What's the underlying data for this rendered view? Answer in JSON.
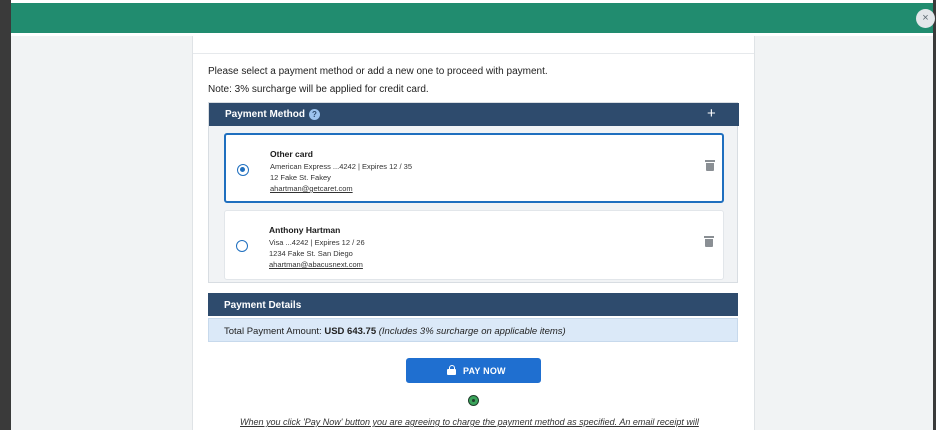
{
  "window": {
    "close_symbol": "×",
    "accent_color": "#218c6f"
  },
  "intro": {
    "line1": "Please select a payment method or add a new one to proceed with payment.",
    "line2": "Note: 3% surcharge will be applied for credit card."
  },
  "payment_method": {
    "title": "Payment Method",
    "help_symbol": "?",
    "add_symbol": "+",
    "cards": [
      {
        "name": "Other card",
        "details": "American Express ...4242 | Expires 12 / 35",
        "address": "12 Fake St. Fakey",
        "email": "ahartman@getcaret.com",
        "selected": true
      },
      {
        "name": "Anthony Hartman",
        "details": "Visa ...4242 | Expires 12 / 26",
        "address": "1234 Fake St. San Diego",
        "email": "ahartman@abacusnext.com",
        "selected": false
      }
    ]
  },
  "payment_details": {
    "title": "Payment Details",
    "total_label": "Total Payment Amount:",
    "total_amount": "USD 643.75",
    "total_note": "(Includes 3% surcharge on applicable items)"
  },
  "pay_button": {
    "label": "PAY NOW",
    "color": "#1f6fd0"
  },
  "icons": {
    "close": "close-icon",
    "help": "help-icon",
    "add": "plus-icon",
    "delete": "trash-icon",
    "lock": "lock-icon",
    "badge": "security-badge-icon"
  },
  "disclaimer": "When you click 'Pay Now' button you are agreeing to charge the payment method as specified. An email receipt will"
}
